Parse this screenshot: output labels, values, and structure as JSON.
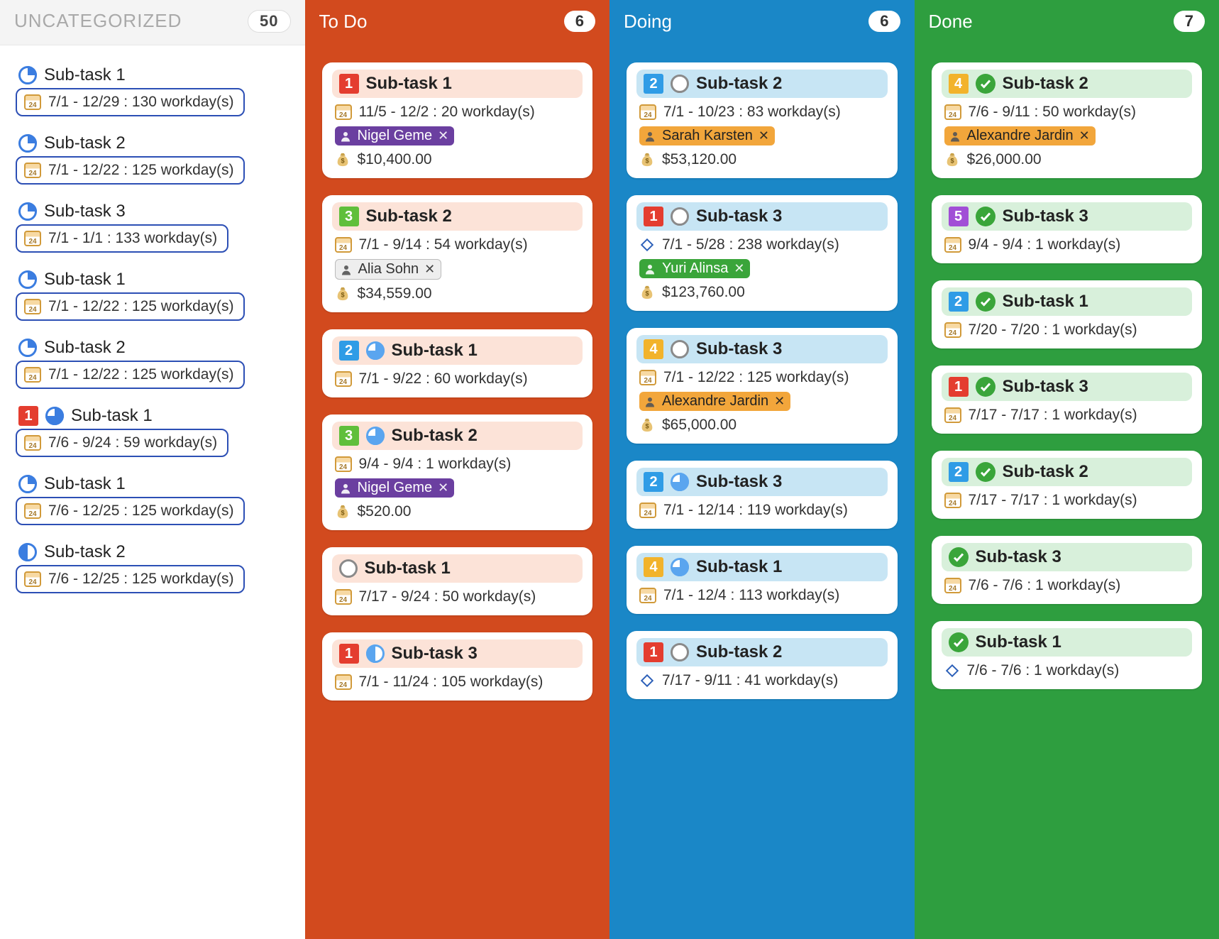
{
  "columns": {
    "uncat": {
      "title": "UNCATEGORIZED",
      "count": "50",
      "cards": [
        {
          "title": "Sub-task 1",
          "pie": "q",
          "dates": "7/1 - 12/29 : 130 workday(s)",
          "num": null
        },
        {
          "title": "Sub-task 2",
          "pie": "q",
          "dates": "7/1 - 12/22 : 125 workday(s)",
          "num": null
        },
        {
          "title": "Sub-task 3",
          "pie": "q",
          "dates": "7/1 - 1/1 : 133 workday(s)",
          "num": null
        },
        {
          "title": "Sub-task 1",
          "pie": "q",
          "dates": "7/1 - 12/22 : 125 workday(s)",
          "num": null
        },
        {
          "title": "Sub-task 2",
          "pie": "q",
          "dates": "7/1 - 12/22 : 125 workday(s)",
          "num": null
        },
        {
          "title": "Sub-task 1",
          "pie": "3q",
          "dates": "7/6 - 9/24 : 59 workday(s)",
          "num": {
            "n": "1",
            "c": "red"
          }
        },
        {
          "title": "Sub-task 1",
          "pie": "q",
          "dates": "7/6 - 12/25 : 125 workday(s)",
          "num": null
        },
        {
          "title": "Sub-task 2",
          "pie": "half",
          "dates": "7/6 - 12/25 : 125 workday(s)",
          "num": null
        }
      ]
    },
    "todo": {
      "title": "To Do",
      "count": "6",
      "bg": "#d24a1e",
      "hdr": "hdr-todo",
      "cards": [
        {
          "num": {
            "n": "1",
            "c": "red"
          },
          "status": null,
          "title": "Sub-task 1",
          "dateIcon": "cal",
          "dates": "11/5 - 12/2 : 20 workday(s)",
          "tag": {
            "name": "Nigel Geme",
            "color": "purple"
          },
          "cost": "$10,400.00"
        },
        {
          "num": {
            "n": "3",
            "c": "green"
          },
          "status": null,
          "title": "Sub-task 2",
          "dateIcon": "cal",
          "dates": "7/1 - 9/14 : 54 workday(s)",
          "tag": {
            "name": "Alia Sohn",
            "color": "gray"
          },
          "cost": "$34,559.00"
        },
        {
          "num": {
            "n": "2",
            "c": "blue"
          },
          "status": "pie-3q",
          "title": "Sub-task 1",
          "dateIcon": "cal",
          "dates": "7/1 - 9/22 : 60 workday(s)",
          "tag": null,
          "cost": null
        },
        {
          "num": {
            "n": "3",
            "c": "green"
          },
          "status": "pie-3q",
          "title": "Sub-task 2",
          "dateIcon": "cal",
          "dates": "9/4 - 9/4 : 1 workday(s)",
          "tag": {
            "name": "Nigel Geme",
            "color": "purple"
          },
          "cost": "$520.00"
        },
        {
          "num": null,
          "status": "empty",
          "title": "Sub-task 1",
          "dateIcon": "cal",
          "dates": "7/17 - 9/24 : 50 workday(s)",
          "tag": null,
          "cost": null
        },
        {
          "num": {
            "n": "1",
            "c": "red"
          },
          "status": "pie-half",
          "title": "Sub-task 3",
          "dateIcon": "cal",
          "dates": "7/1 - 11/24 : 105 workday(s)",
          "tag": null,
          "cost": null
        }
      ]
    },
    "doing": {
      "title": "Doing",
      "count": "6",
      "bg": "#1a87c7",
      "hdr": "hdr-doing",
      "cards": [
        {
          "num": {
            "n": "2",
            "c": "blue"
          },
          "status": "empty",
          "title": "Sub-task 2",
          "dateIcon": "cal",
          "dates": "7/1 - 10/23 : 83 workday(s)",
          "tag": {
            "name": "Sarah Karsten",
            "color": "orange"
          },
          "cost": "$53,120.00"
        },
        {
          "num": {
            "n": "1",
            "c": "red"
          },
          "status": "empty",
          "title": "Sub-task 3",
          "dateIcon": "diamond",
          "dates": "7/1 - 5/28 : 238 workday(s)",
          "tag": {
            "name": "Yuri Alinsa",
            "color": "green"
          },
          "cost": "$123,760.00"
        },
        {
          "num": {
            "n": "4",
            "c": "gold"
          },
          "status": "empty",
          "title": "Sub-task 3",
          "dateIcon": "cal",
          "dates": "7/1 - 12/22 : 125 workday(s)",
          "tag": {
            "name": "Alexandre Jardin",
            "color": "orange"
          },
          "cost": "$65,000.00"
        },
        {
          "num": {
            "n": "2",
            "c": "blue"
          },
          "status": "pie-3q",
          "title": "Sub-task 3",
          "dateIcon": "cal",
          "dates": "7/1 - 12/14 : 119 workday(s)",
          "tag": null,
          "cost": null
        },
        {
          "num": {
            "n": "4",
            "c": "gold"
          },
          "status": "pie-3q",
          "title": "Sub-task 1",
          "dateIcon": "cal",
          "dates": "7/1 - 12/4 : 113 workday(s)",
          "tag": null,
          "cost": null
        },
        {
          "num": {
            "n": "1",
            "c": "red"
          },
          "status": "empty",
          "title": "Sub-task 2",
          "dateIcon": "diamond",
          "dates": "7/17 - 9/11 : 41 workday(s)",
          "tag": null,
          "cost": null
        }
      ]
    },
    "done": {
      "title": "Done",
      "count": "7",
      "bg": "#2e9e3f",
      "hdr": "hdr-done",
      "cards": [
        {
          "num": {
            "n": "4",
            "c": "gold"
          },
          "status": "check",
          "title": "Sub-task 2",
          "dateIcon": "cal",
          "dates": "7/6 - 9/11 : 50 workday(s)",
          "tag": {
            "name": "Alexandre Jardin",
            "color": "orange"
          },
          "cost": "$26,000.00"
        },
        {
          "num": {
            "n": "5",
            "c": "purple"
          },
          "status": "check",
          "title": "Sub-task 3",
          "dateIcon": "cal",
          "dates": "9/4 - 9/4 : 1 workday(s)",
          "tag": null,
          "cost": null
        },
        {
          "num": {
            "n": "2",
            "c": "blue"
          },
          "status": "check",
          "title": "Sub-task 1",
          "dateIcon": "cal",
          "dates": "7/20 - 7/20 : 1 workday(s)",
          "tag": null,
          "cost": null
        },
        {
          "num": {
            "n": "1",
            "c": "red"
          },
          "status": "check",
          "title": "Sub-task 3",
          "dateIcon": "cal",
          "dates": "7/17 - 7/17 : 1 workday(s)",
          "tag": null,
          "cost": null
        },
        {
          "num": {
            "n": "2",
            "c": "blue"
          },
          "status": "check",
          "title": "Sub-task 2",
          "dateIcon": "cal",
          "dates": "7/17 - 7/17 : 1 workday(s)",
          "tag": null,
          "cost": null
        },
        {
          "num": null,
          "status": "check",
          "title": "Sub-task 3",
          "dateIcon": "cal",
          "dates": "7/6 - 7/6 : 1 workday(s)",
          "tag": null,
          "cost": null
        },
        {
          "num": null,
          "status": "check",
          "title": "Sub-task 1",
          "dateIcon": "diamond",
          "dates": "7/6 - 7/6 : 1 workday(s)",
          "tag": null,
          "cost": null
        }
      ]
    }
  }
}
